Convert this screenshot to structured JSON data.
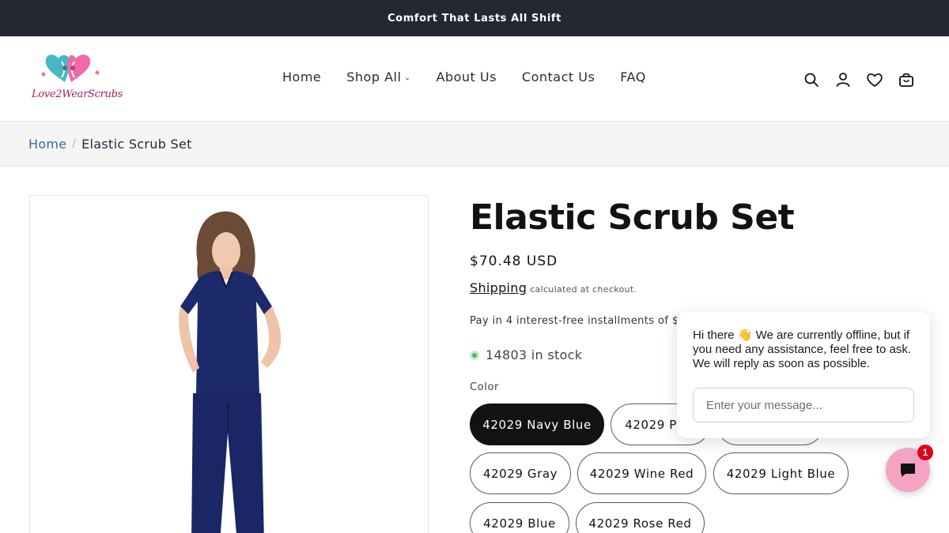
{
  "announcement": "Comfort That Lasts All Shift",
  "brand": {
    "logo_text": "Love2WearScrubs"
  },
  "nav": {
    "items": [
      {
        "label": "Home"
      },
      {
        "label": "Shop All"
      },
      {
        "label": "About Us"
      },
      {
        "label": "Contact Us"
      },
      {
        "label": "FAQ"
      }
    ],
    "shop_all_chevron": "⌄"
  },
  "header_icons": [
    "search-icon",
    "account-icon",
    "wishlist-heart-icon",
    "cart-icon"
  ],
  "breadcrumb": {
    "home": "Home",
    "separator": "/",
    "current": "Elastic Scrub Set"
  },
  "product": {
    "title": "Elastic Scrub Set",
    "price": "$70.48 USD",
    "shipping_link": "Shipping",
    "shipping_note": "calculated at checkout.",
    "installments": "Pay in 4 interest-free installments of $17",
    "stock": "14803 in stock",
    "stock_color": "#4bbf5f",
    "color_label": "Color",
    "colors": [
      {
        "label": "42029 Navy Blue",
        "selected": true
      },
      {
        "label": "42029 Pink",
        "selected": false
      },
      {
        "label": "42029 Black",
        "selected": false
      },
      {
        "label": "42029 Gray",
        "selected": false
      },
      {
        "label": "42029 Wine Red",
        "selected": false
      },
      {
        "label": "42029 Light Blue",
        "selected": false
      },
      {
        "label": "42029 Blue",
        "selected": false
      },
      {
        "label": "42029 Rose Red",
        "selected": false
      }
    ],
    "image_alt": "Woman wearing navy blue elastic scrub set",
    "garment_color": "#1c2a6b"
  },
  "chat": {
    "greeting_prefix": "Hi there",
    "greeting_emoji": "👋",
    "greeting_body": "We are currently offline, but if you need any assistance, feel free to ask. We will reply as soon as possible.",
    "input_placeholder": "Enter your message...",
    "badge_count": "1",
    "button_color": "#f5a3c3"
  },
  "colors": {
    "announcement_bg": "#242833",
    "breadcrumb_link": "#3a6aa6",
    "selected_swatch": "#121212"
  }
}
